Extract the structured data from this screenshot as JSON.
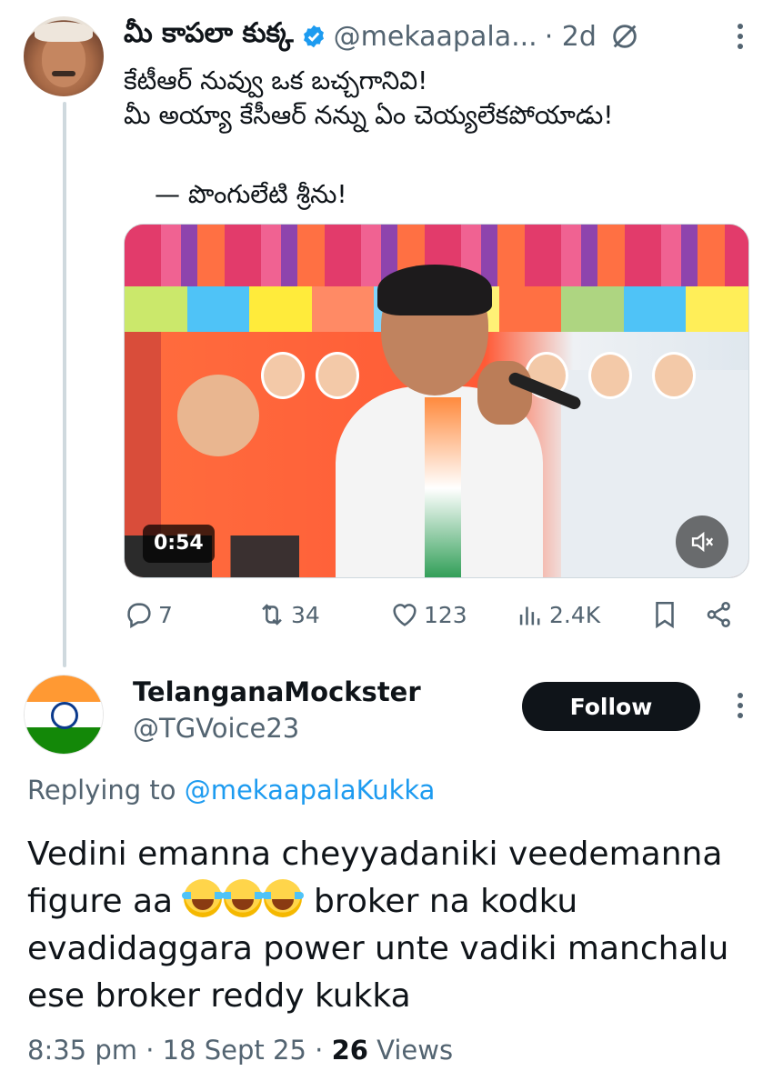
{
  "tweet1": {
    "name": "మీ కాపలా కుక్క",
    "handle": "@mekaapala...",
    "time": "· 2d",
    "lines": [
      "కేటీఆర్ నువ్వు ఒక బచ్చగానివి!",
      "మీ అయ్యా కేసీఆర్ నన్ను ఏం చెయ్యలేకపోయాడు!"
    ],
    "quote": "— పొంగులేటి శ్రీను!",
    "video_duration": "0:54",
    "actions": {
      "replies": "7",
      "retweets": "34",
      "likes": "123",
      "views": "2.4K"
    }
  },
  "tweet2": {
    "name": "TelanganaMockster",
    "handle": "@TGVoice23",
    "follow_label": "Follow",
    "replying_prefix": "Replying to",
    "replying_mention": "@mekaapalaKukka",
    "line1": "Vedini emanna cheyyadaniki veedemanna",
    "line2_pre": "figure aa",
    "line2_post": "broker na kodku",
    "line3": "evadidaggara power unte vadiki manchalu",
    "line4": "ese broker reddy kukka",
    "emoji": "face-with-tears-of-joy",
    "time": "8:35 pm · 18 Sept 25 ·",
    "views_count": "26",
    "views_label": "Views"
  },
  "colors": {
    "text": "#0f1419",
    "muted": "#536471",
    "link": "#1d9bf0",
    "verified": "#1d9bf0",
    "follow_bg": "#0f1419"
  }
}
